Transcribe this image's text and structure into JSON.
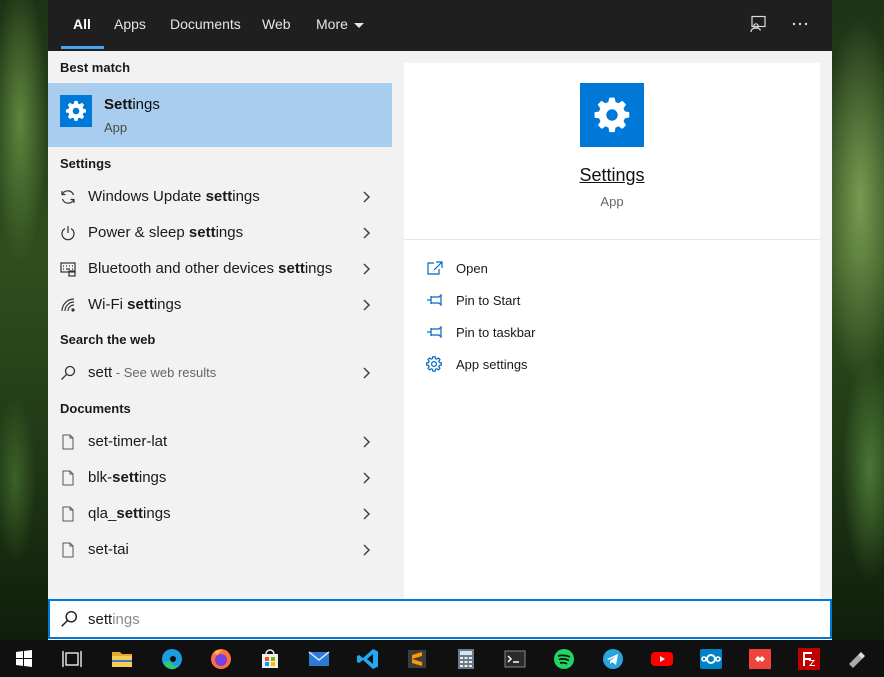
{
  "tabs": [
    {
      "label": "All",
      "active": true
    },
    {
      "label": "Apps",
      "active": false
    },
    {
      "label": "Documents",
      "active": false
    },
    {
      "label": "Web",
      "active": false
    },
    {
      "label": "More",
      "active": false
    }
  ],
  "topbar_icons": [
    "feedback-icon",
    "more-options-icon"
  ],
  "sections": {
    "best_match": "Best match",
    "settings": "Settings",
    "search_web": "Search the web",
    "documents": "Documents"
  },
  "best_match": {
    "title_bold": "Sett",
    "title_rest": "ings",
    "subtitle": "App",
    "icon": "gear-icon"
  },
  "settings_items": [
    {
      "pre": "Windows Update ",
      "bold": "sett",
      "post": "ings",
      "icon": "refresh-icon"
    },
    {
      "pre": "Power & sleep ",
      "bold": "sett",
      "post": "ings",
      "icon": "power-icon"
    },
    {
      "pre": "Bluetooth and other devices ",
      "bold": "sett",
      "post": "ings",
      "icon": "keyboard-icon"
    },
    {
      "pre": "Wi-Fi ",
      "bold": "sett",
      "post": "ings",
      "icon": "wifi-icon"
    }
  ],
  "web_result": {
    "query": "sett",
    "hint": " - See web results",
    "icon": "search-icon"
  },
  "documents": [
    {
      "pre": "set-timer-lat",
      "bold": "",
      "post": ""
    },
    {
      "pre": "blk-",
      "bold": "sett",
      "post": "ings"
    },
    {
      "pre": "qla_",
      "bold": "sett",
      "post": "ings"
    },
    {
      "pre": "set-tai",
      "bold": "",
      "post": ""
    }
  ],
  "detail": {
    "title": "Settings",
    "subtitle": "App",
    "actions": [
      {
        "label": "Open",
        "icon": "open-icon"
      },
      {
        "label": "Pin to Start",
        "icon": "pin-icon"
      },
      {
        "label": "Pin to taskbar",
        "icon": "pin-icon"
      },
      {
        "label": "App settings",
        "icon": "gear-icon"
      }
    ]
  },
  "search": {
    "typed": "sett",
    "suggestion": "ings"
  },
  "taskbar": [
    "windows-start-icon",
    "task-view-icon",
    "file-explorer-icon",
    "edge-icon",
    "firefox-icon",
    "microsoft-store-icon",
    "mail-icon",
    "vscode-icon",
    "sublime-text-icon",
    "calculator-icon",
    "terminal-icon",
    "spotify-icon",
    "telegram-icon",
    "youtube-icon",
    "nextcloud-icon",
    "anydesk-icon",
    "filezilla-icon",
    "usb-drive-icon"
  ],
  "colors": {
    "accent": "#0078d7",
    "selection": "#a9cdef",
    "topbar": "#1f1f1f",
    "tab_underline": "#4aa6f0"
  }
}
